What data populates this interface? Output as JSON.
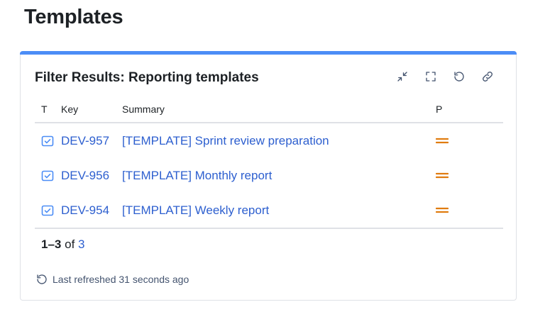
{
  "page": {
    "title": "Templates"
  },
  "gadget": {
    "title": "Filter Results: Reporting templates",
    "accent_color": "#4c8df6",
    "toolbar": [
      {
        "icon": "minimize-icon"
      },
      {
        "icon": "fullscreen-icon"
      },
      {
        "icon": "refresh-icon"
      },
      {
        "icon": "link-icon"
      }
    ],
    "columns": {
      "t": "T",
      "key": "Key",
      "summary": "Summary",
      "p": "P"
    },
    "rows": [
      {
        "type_icon": "task-icon",
        "key": "DEV-957",
        "summary": "[TEMPLATE] Sprint review preparation",
        "priority_icon": "priority-medium-icon"
      },
      {
        "type_icon": "task-icon",
        "key": "DEV-956",
        "summary": "[TEMPLATE] Monthly report",
        "priority_icon": "priority-medium-icon"
      },
      {
        "type_icon": "task-icon",
        "key": "DEV-954",
        "summary": "[TEMPLATE] Weekly report",
        "priority_icon": "priority-medium-icon"
      }
    ],
    "pager": {
      "range": "1–3",
      "of_label": "of",
      "total": "3"
    },
    "last_refreshed": "Last refreshed 31 seconds ago",
    "colors": {
      "link": "#2d5fcf",
      "priority_medium": "#e07c10",
      "task_icon": "#4b8df6"
    }
  }
}
